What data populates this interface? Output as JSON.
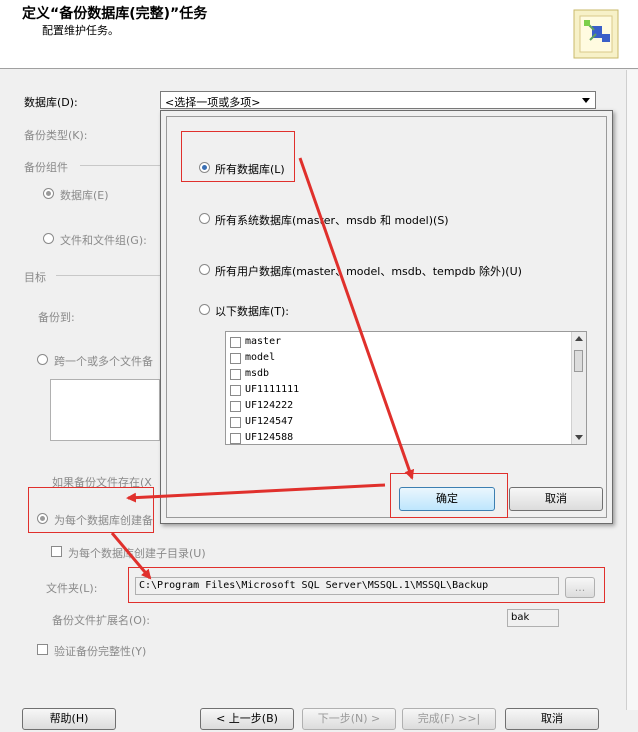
{
  "header": {
    "title": "定义“备份数据库(完整)”任务",
    "subtitle": "配置维护任务。"
  },
  "form": {
    "database_label": "数据库(D):",
    "database_value": "<选择一项或多项>",
    "backup_type_label": "备份类型(K):",
    "backup_component_label": "备份组件",
    "component_database_label": "数据库(E)",
    "component_files_label": "文件和文件组(G):",
    "target_label": "目标",
    "backup_to_label": "备份到:",
    "span_files_label": "跨一个或多个文件备",
    "if_exists_label": "如果备份文件存在(X",
    "per_database_label": "为每个数据库创建备",
    "subdir_label": "为每个数据库创建子目录(U)",
    "folder_label": "文件夹(L):",
    "folder_value": "C:\\Program Files\\Microsoft SQL Server\\MSSQL.1\\MSSQL\\Backup",
    "browse_label": "...",
    "extension_label": "备份文件扩展名(O):",
    "extension_value": "bak",
    "verify_label": "验证备份完整性(Y)"
  },
  "popup": {
    "options": [
      {
        "label": "所有数据库(L)",
        "selected": true
      },
      {
        "label": "所有系统数据库(master、msdb 和 model)(S)",
        "selected": false
      },
      {
        "label": "所有用户数据库(master、model、msdb、tempdb 除外)(U)",
        "selected": false
      },
      {
        "label": "以下数据库(T):",
        "selected": false
      }
    ],
    "databases": [
      "master",
      "model",
      "msdb",
      "UF1111111",
      "UF124222",
      "UF124547",
      "UF124588"
    ],
    "ok_label": "确定",
    "cancel_label": "取消"
  },
  "footer": {
    "help_label": "帮助(H)",
    "prev_label": "< 上一步(B)",
    "next_label": "下一步(N) >",
    "finish_label": "完成(F) >>|",
    "cancel_label": "取消"
  },
  "colors": {
    "annotation_red": "#e0302c",
    "accent": "#3c7fb1"
  }
}
